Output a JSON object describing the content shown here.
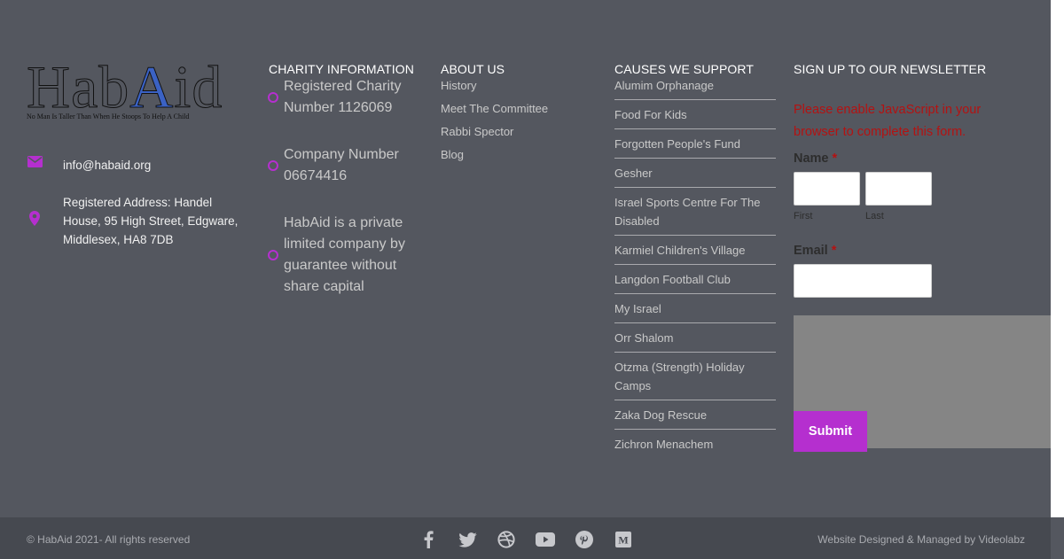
{
  "logo": {
    "word_plain": "Hab",
    "word_highlight_a": "A",
    "word_i": "i",
    "word_rest": "d",
    "tagline": "No Man Is Taller Than When He Stoops To Help A Child"
  },
  "contact": {
    "email": "info@habaid.org",
    "address": "Registered Address: Handel House, 95 High Street, Edgware, Middlesex, HA8 7DB"
  },
  "charity": {
    "title": "CHARITY INFORMATION",
    "items": [
      "Registered Charity Number 1126069",
      "Company Number 06674416",
      "HabAid is a private limited company by guarantee without share capital"
    ]
  },
  "about": {
    "title": "ABOUT US",
    "items": [
      "History",
      "Meet The Committee",
      "Rabbi Spector",
      "Blog"
    ]
  },
  "causes": {
    "title": "CAUSES WE SUPPORT",
    "items": [
      "Alumim Orphanage",
      "Food For Kids",
      "Forgotten People's Fund",
      "Gesher",
      "Israel Sports Centre For The Disabled",
      "Karmiel Children's Village",
      "Langdon Football Club",
      "My Israel",
      "Orr Shalom",
      "Otzma (Strength) Holiday Camps",
      "Zaka Dog Rescue",
      "Zichron Menachem"
    ]
  },
  "newsletter": {
    "title": "SIGN UP TO OUR NEWSLETTER",
    "js_message": "Please enable JavaScript in your browser to complete this form.",
    "name_label": "Name",
    "required_mark": "*",
    "first_label": "First",
    "last_label": "Last",
    "email_label": "Email",
    "submit_label": "Submit"
  },
  "bottom": {
    "copyright": "© HabAid 2021- All rights reserved",
    "credit": "Website Designed & Managed by Videolabz",
    "social_icons": [
      "facebook-icon",
      "twitter-icon",
      "dribbble-icon",
      "youtube-icon",
      "pinterest-icon",
      "medium-icon"
    ]
  },
  "colors": {
    "background": "#54575f",
    "bottom_bar": "#464950",
    "accent": "#b52fcf",
    "error": "#b41212"
  }
}
